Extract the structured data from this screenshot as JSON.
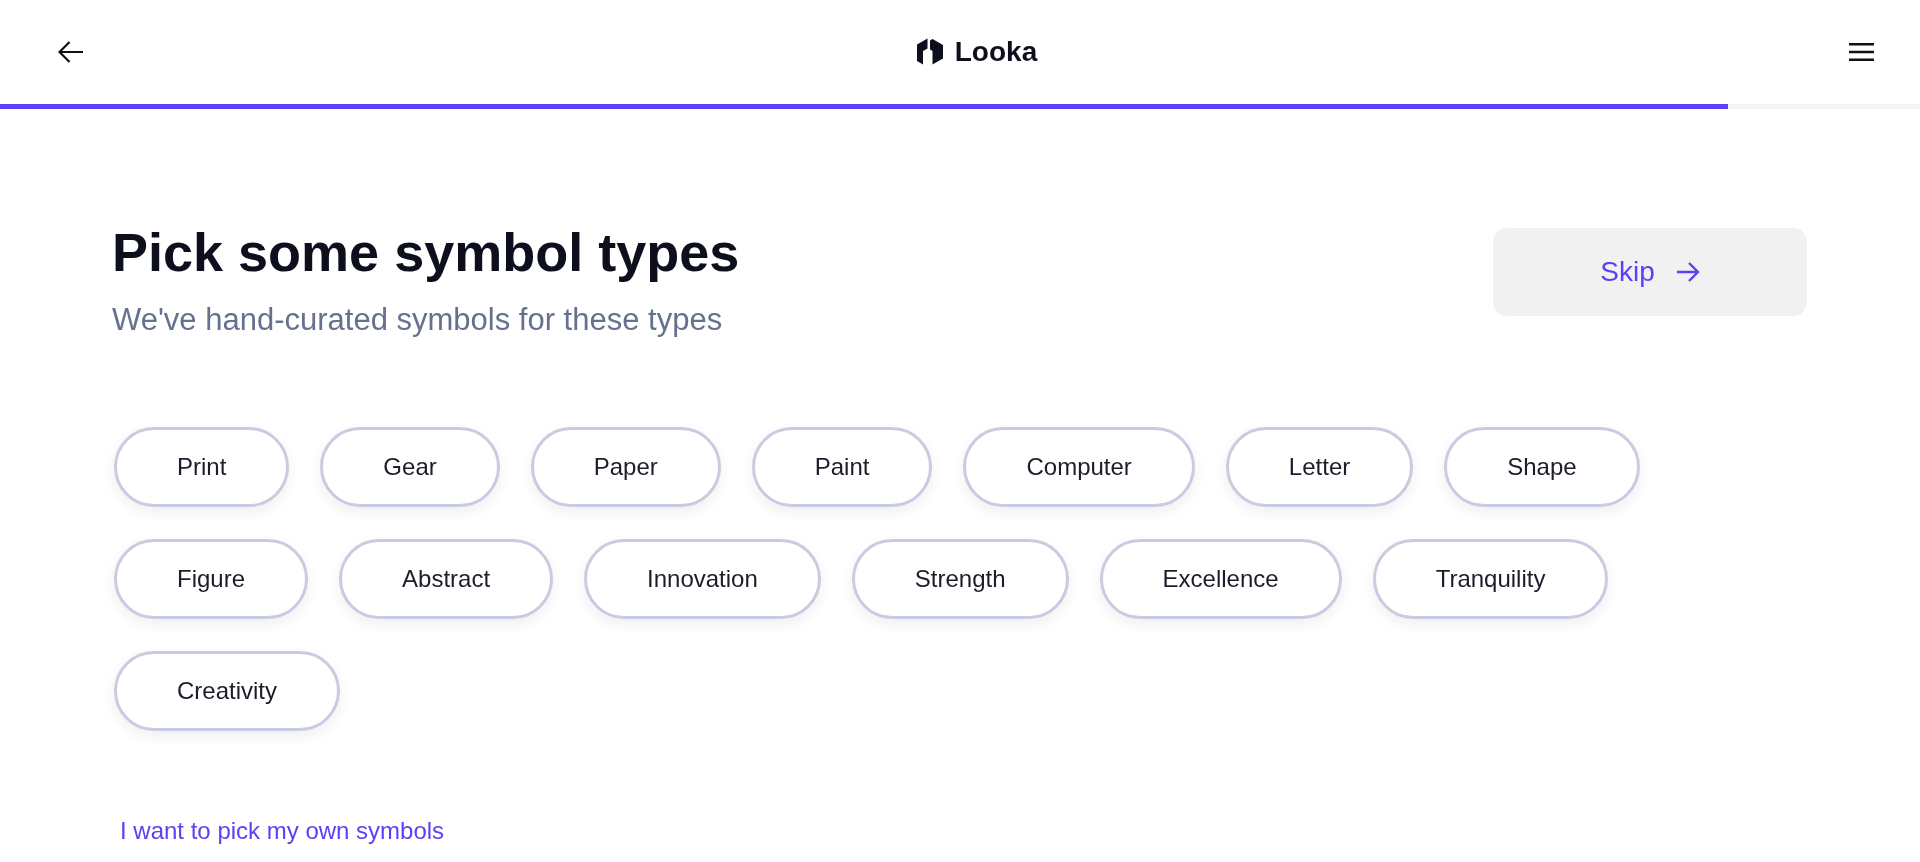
{
  "header": {
    "logo_text": "Looka"
  },
  "progress": {
    "level": 0.9
  },
  "heading": {
    "title": "Pick some symbol types",
    "subtitle": "We've hand-curated symbols for these types"
  },
  "skip_button": {
    "label": "Skip"
  },
  "symbol_types": [
    {
      "label": "Print",
      "selected": false
    },
    {
      "label": "Gear",
      "selected": false
    },
    {
      "label": "Paper",
      "selected": false
    },
    {
      "label": "Paint",
      "selected": false
    },
    {
      "label": "Computer",
      "selected": false
    },
    {
      "label": "Letter",
      "selected": false
    },
    {
      "label": "Shape",
      "selected": false
    },
    {
      "label": "Figure",
      "selected": false
    },
    {
      "label": "Abstract",
      "selected": false
    },
    {
      "label": "Innovation",
      "selected": false
    },
    {
      "label": "Strength",
      "selected": false
    },
    {
      "label": "Excellence",
      "selected": false
    },
    {
      "label": "Tranquility",
      "selected": false
    },
    {
      "label": "Creativity",
      "selected": false
    }
  ],
  "own_symbols_link": {
    "label": "I want to pick my own symbols"
  }
}
